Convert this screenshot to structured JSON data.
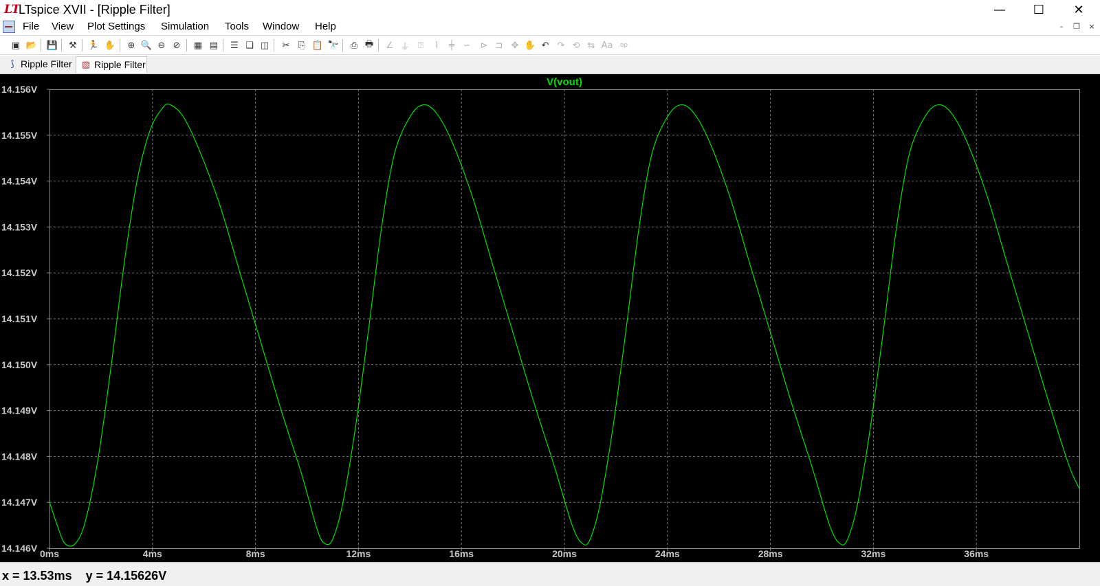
{
  "window": {
    "title": "LTspice XVII - [Ripple Filter]",
    "logo": "LT",
    "controls": {
      "minimize": "—",
      "maximize": "☐",
      "close": "✕"
    }
  },
  "menu": [
    "File",
    "View",
    "Plot Settings",
    "Simulation",
    "Tools",
    "Window",
    "Help"
  ],
  "mdi_controls": {
    "minimize": "–",
    "restore": "❐",
    "close": "×"
  },
  "toolbar_icons": [
    {
      "name": "new-schematic-icon",
      "glyph": "▣",
      "enabled": true
    },
    {
      "name": "open-icon",
      "glyph": "📂",
      "enabled": true
    },
    {
      "name": "save-icon",
      "glyph": "💾",
      "enabled": true
    },
    {
      "name": "control-panel-icon",
      "glyph": "⚒",
      "enabled": true
    },
    {
      "name": "run-icon",
      "glyph": "🏃",
      "enabled": true
    },
    {
      "name": "pan-icon",
      "glyph": "✋",
      "enabled": true
    },
    {
      "name": "zoom-in-icon",
      "glyph": "⊕",
      "enabled": true
    },
    {
      "name": "zoom-area-icon",
      "glyph": "🔍",
      "enabled": true
    },
    {
      "name": "zoom-out-icon",
      "glyph": "⊖",
      "enabled": true
    },
    {
      "name": "zoom-cancel-icon",
      "glyph": "⊘",
      "enabled": true
    },
    {
      "name": "autorange-icon",
      "glyph": "▦",
      "enabled": true
    },
    {
      "name": "fft-icon",
      "glyph": "▤",
      "enabled": true
    },
    {
      "name": "tile-horizontal-icon",
      "glyph": "☰",
      "enabled": true
    },
    {
      "name": "cascade-icon",
      "glyph": "❏",
      "enabled": true
    },
    {
      "name": "tile-vertical-icon",
      "glyph": "◫",
      "enabled": true
    },
    {
      "name": "cut-icon",
      "glyph": "✂",
      "enabled": true
    },
    {
      "name": "copy-icon",
      "glyph": "⎘",
      "enabled": true
    },
    {
      "name": "paste-icon",
      "glyph": "📋",
      "enabled": true
    },
    {
      "name": "find-icon",
      "glyph": "🔭",
      "enabled": true
    },
    {
      "name": "print-icon",
      "glyph": "⎙",
      "enabled": true
    },
    {
      "name": "print-setup-icon",
      "glyph": "🖶",
      "enabled": true
    },
    {
      "name": "draw-wire-icon",
      "glyph": "∠",
      "enabled": false
    },
    {
      "name": "ground-icon",
      "glyph": "⏚",
      "enabled": false
    },
    {
      "name": "label-net-icon",
      "glyph": "⍰",
      "enabled": false
    },
    {
      "name": "resistor-icon",
      "glyph": "⌇",
      "enabled": false
    },
    {
      "name": "capacitor-icon",
      "glyph": "╪",
      "enabled": false
    },
    {
      "name": "inductor-icon",
      "glyph": "∽",
      "enabled": false
    },
    {
      "name": "diode-icon",
      "glyph": "⊳",
      "enabled": false
    },
    {
      "name": "component-icon",
      "glyph": "⊐",
      "enabled": false
    },
    {
      "name": "move-icon",
      "glyph": "✥",
      "enabled": false
    },
    {
      "name": "drag-icon",
      "glyph": "✋",
      "enabled": false
    },
    {
      "name": "undo-icon",
      "glyph": "↶",
      "enabled": true
    },
    {
      "name": "redo-icon",
      "glyph": "↷",
      "enabled": false
    },
    {
      "name": "rotate-icon",
      "glyph": "⟲",
      "enabled": false
    },
    {
      "name": "mirror-icon",
      "glyph": "⇆",
      "enabled": false
    },
    {
      "name": "text-icon",
      "glyph": "Aa",
      "enabled": false
    },
    {
      "name": "spice-directive-icon",
      "glyph": ".op",
      "enabled": false
    }
  ],
  "tabs": [
    {
      "label": "Ripple Filter",
      "icon": "schematic-tab-icon",
      "glyph": "⟆",
      "active": false
    },
    {
      "label": "Ripple Filter",
      "icon": "waveform-tab-icon",
      "glyph": "▨",
      "active": true
    }
  ],
  "colors": {
    "trace": "#00e000",
    "plot_bg": "#000000",
    "grid": "#7a7a7a",
    "tick_text": "#c8c8c8"
  },
  "chart_data": {
    "type": "line",
    "title": "V(vout)",
    "xlabel": "",
    "ylabel": "",
    "x_ticks": [
      "0ms",
      "4ms",
      "8ms",
      "12ms",
      "16ms",
      "20ms",
      "24ms",
      "28ms",
      "32ms",
      "36ms"
    ],
    "y_ticks": [
      "14.146V",
      "14.147V",
      "14.148V",
      "14.149V",
      "14.150V",
      "14.151V",
      "14.152V",
      "14.153V",
      "14.154V",
      "14.155V",
      "14.156V"
    ],
    "xlim": [
      0,
      40
    ],
    "ylim": [
      14.146,
      14.156
    ],
    "grid": true,
    "series": [
      {
        "name": "V(vout)",
        "x_unit": "ms",
        "y_unit": "V",
        "points": [
          [
            0.0,
            14.147
          ],
          [
            0.3,
            14.1465
          ],
          [
            0.6,
            14.1461
          ],
          [
            1.0,
            14.1461
          ],
          [
            1.4,
            14.1466
          ],
          [
            1.9,
            14.148
          ],
          [
            2.4,
            14.15
          ],
          [
            2.9,
            14.1522
          ],
          [
            3.4,
            14.154
          ],
          [
            3.9,
            14.1551
          ],
          [
            4.4,
            14.1556
          ],
          [
            4.7,
            14.15566
          ],
          [
            5.2,
            14.1554
          ],
          [
            5.8,
            14.1547
          ],
          [
            6.6,
            14.1535
          ],
          [
            7.4,
            14.152
          ],
          [
            8.2,
            14.1505
          ],
          [
            9.0,
            14.149
          ],
          [
            9.8,
            14.1476
          ],
          [
            10.4,
            14.1464
          ],
          [
            10.7,
            14.1461
          ],
          [
            11.0,
            14.1462
          ],
          [
            11.4,
            14.147
          ],
          [
            11.9,
            14.1487
          ],
          [
            12.4,
            14.1508
          ],
          [
            12.9,
            14.153
          ],
          [
            13.4,
            14.1546
          ],
          [
            14.0,
            14.1554
          ],
          [
            14.5,
            14.15566
          ],
          [
            15.0,
            14.1555
          ],
          [
            15.6,
            14.1549
          ],
          [
            16.4,
            14.1537
          ],
          [
            17.2,
            14.1522
          ],
          [
            18.0,
            14.1507
          ],
          [
            18.8,
            14.1492
          ],
          [
            19.6,
            14.1478
          ],
          [
            20.3,
            14.1465
          ],
          [
            20.7,
            14.1461
          ],
          [
            21.0,
            14.1462
          ],
          [
            21.4,
            14.147
          ],
          [
            21.9,
            14.1487
          ],
          [
            22.4,
            14.1508
          ],
          [
            22.9,
            14.153
          ],
          [
            23.4,
            14.1546
          ],
          [
            24.0,
            14.1554
          ],
          [
            24.5,
            14.15566
          ],
          [
            25.0,
            14.1555
          ],
          [
            25.6,
            14.1549
          ],
          [
            26.4,
            14.1537
          ],
          [
            27.2,
            14.1522
          ],
          [
            28.0,
            14.1507
          ],
          [
            28.8,
            14.1492
          ],
          [
            29.6,
            14.1478
          ],
          [
            30.3,
            14.1465
          ],
          [
            30.7,
            14.1461
          ],
          [
            31.0,
            14.1462
          ],
          [
            31.4,
            14.147
          ],
          [
            31.9,
            14.1487
          ],
          [
            32.4,
            14.1508
          ],
          [
            32.9,
            14.153
          ],
          [
            33.4,
            14.1546
          ],
          [
            34.0,
            14.1554
          ],
          [
            34.5,
            14.15566
          ],
          [
            35.0,
            14.1555
          ],
          [
            35.6,
            14.1549
          ],
          [
            36.4,
            14.1537
          ],
          [
            37.2,
            14.1522
          ],
          [
            38.0,
            14.1507
          ],
          [
            38.8,
            14.1492
          ],
          [
            39.6,
            14.1478
          ],
          [
            40.0,
            14.1473
          ]
        ]
      }
    ]
  },
  "status": {
    "cursor_readout": "x = 13.53ms    y = 14.15626V"
  }
}
